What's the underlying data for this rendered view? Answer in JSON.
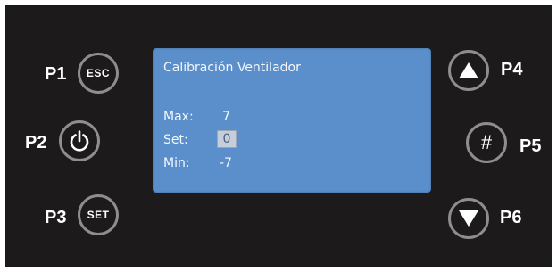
{
  "panel": {
    "background": "#1d1a1b",
    "button_ring_color": "#8e8e8e"
  },
  "buttons": {
    "p1": {
      "label": "P1",
      "text": "ESC"
    },
    "p2": {
      "label": "P2",
      "icon": "power-icon"
    },
    "p3": {
      "label": "P3",
      "text": "SET"
    },
    "p4": {
      "label": "P4",
      "icon": "up-triangle-icon"
    },
    "p5": {
      "label": "P5",
      "text": "#"
    },
    "p6": {
      "label": "P6",
      "icon": "down-triangle-icon"
    }
  },
  "screen": {
    "background": "#5b8fcb",
    "title": "Calibración Ventilador",
    "rows": [
      {
        "label": "Max:",
        "value": "7"
      },
      {
        "label": "Set:",
        "value": "0"
      },
      {
        "label": "Min:",
        "value": "-7"
      }
    ]
  }
}
